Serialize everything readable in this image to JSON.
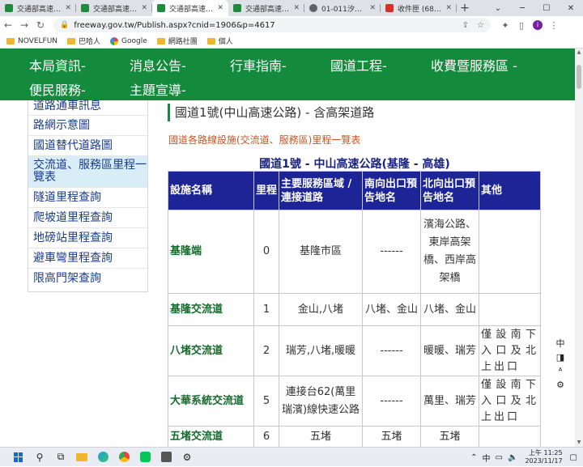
{
  "browser": {
    "tabs": [
      {
        "title": "交通部高速公路局",
        "favicon_color": "#1f8b3f",
        "active": false
      },
      {
        "title": "交通部高速公路局",
        "favicon_color": "#1f8b3f",
        "active": false
      },
      {
        "title": "交通部高速公路局",
        "favicon_color": "#1f8b3f",
        "active": true
      },
      {
        "title": "交通部高速公路局",
        "favicon_color": "#1f8b3f",
        "active": false
      },
      {
        "title": "01-011汐止 - 汐止",
        "favicon_color": "#5f6368",
        "active": false
      },
      {
        "title": "收件匣 (682) - blu",
        "favicon_color": "#d93025",
        "active": false
      }
    ],
    "url": "freeway.gov.tw/Publish.aspx?cnid=1906&p=4617",
    "bookmarks": [
      "NOVELFUN",
      "巴哈人",
      "Google",
      "網路社團",
      "個人"
    ],
    "profile_initial": "i"
  },
  "mainnav": {
    "items": [
      "本局資訊-",
      "消息公告-",
      "行車指南-",
      "國道工程-",
      "收費暨服務區 -",
      "便民服務-",
      "主題宣導-"
    ]
  },
  "sidemenu": {
    "items": [
      "道路通車訊息",
      "路網示意圖",
      "國道替代道路圖",
      "交流道、服務區里程一覽表",
      "隧道里程查詢",
      "爬坡道里程查詢",
      "地磅站里程查詢",
      "避車彎里程查詢",
      "限高門架查詢"
    ],
    "selected_index": 3
  },
  "content": {
    "page_title": "國道1號(中山高速公路) - 含高架道路",
    "subtitle": "國道各路線設施(交流道、服務區)里程一覽表",
    "caption": "國道1號 - 中山高速公路(基隆 - 高雄)",
    "headers": [
      "設施名稱",
      "里程",
      "主要服務區域 / 連接道路",
      "南向出口預告地名",
      "北向出口預告地名",
      "其他"
    ],
    "rows": [
      {
        "name": "基隆端",
        "km": "0",
        "area": "基隆市區",
        "south": "------",
        "north": "濱海公路、東岸高架橋、西岸高架橋",
        "note": ""
      },
      {
        "name": "基隆交流道",
        "km": "1",
        "area": "金山,八堵",
        "south": "八堵、金山",
        "north": "八堵、金山",
        "note": ""
      },
      {
        "name": "八堵交流道",
        "km": "2",
        "area": "瑞芳,八堵,暖暖",
        "south": "------",
        "north": "暖暖、瑞芳",
        "note": "僅設南下入口及北上出口"
      },
      {
        "name": "大華系統交流道",
        "km": "5",
        "area": "連接台62(萬里瑞濱)線快速公路",
        "south": "------",
        "north": "萬里、瑞芳",
        "note": "僅設南下入口及北上出口"
      },
      {
        "name": "五堵交流道",
        "km": "6",
        "area": "五堵",
        "south": "五堵",
        "north": "五堵",
        "note": ""
      }
    ]
  },
  "floattools": [
    "中",
    "◨",
    "⚙"
  ],
  "taskbar": {
    "time": "上午 11:25",
    "date": "2023/11/17",
    "ime": "中"
  }
}
